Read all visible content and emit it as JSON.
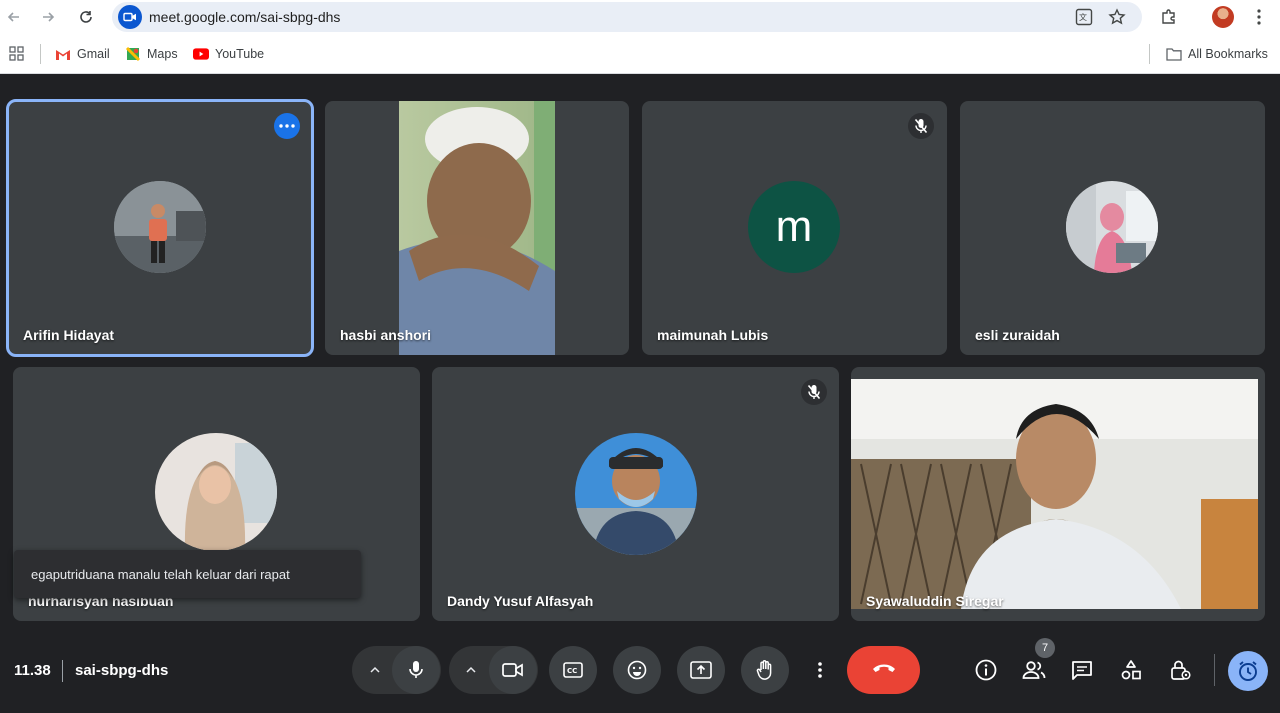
{
  "browser": {
    "url": "meet.google.com/sai-sbpg-dhs",
    "bookmarks": [
      {
        "label": "Gmail",
        "icon": "gmail-icon"
      },
      {
        "label": "Maps",
        "icon": "maps-icon"
      },
      {
        "label": "YouTube",
        "icon": "youtube-icon"
      }
    ],
    "all_bookmarks": "All Bookmarks"
  },
  "participants": [
    {
      "name": "Arifin Hidayat",
      "type": "avatar-photo",
      "active_speaker_outline": true
    },
    {
      "name": "hasbi anshori",
      "type": "video"
    },
    {
      "name": "maimunah Lubis",
      "type": "letter-avatar",
      "letter": "m",
      "muted": true
    },
    {
      "name": "esli zuraidah",
      "type": "avatar-photo"
    },
    {
      "name": "nurharisyan hasibuan",
      "type": "avatar-photo"
    },
    {
      "name": "Dandy Yusuf Alfasyah",
      "type": "avatar-photo",
      "muted": true
    },
    {
      "name": "Syawaluddin Siregar",
      "type": "video"
    }
  ],
  "toast": "egaputriduana manalu telah keluar dari rapat",
  "meeting": {
    "time": "11.38",
    "code": "sai-sbpg-dhs",
    "participant_count": "7"
  },
  "colors": {
    "background": "#202124",
    "tile": "#3c4043",
    "end_call": "#ea4335",
    "accent": "#8ab4f8",
    "letter_avatar": "#0d5344"
  }
}
